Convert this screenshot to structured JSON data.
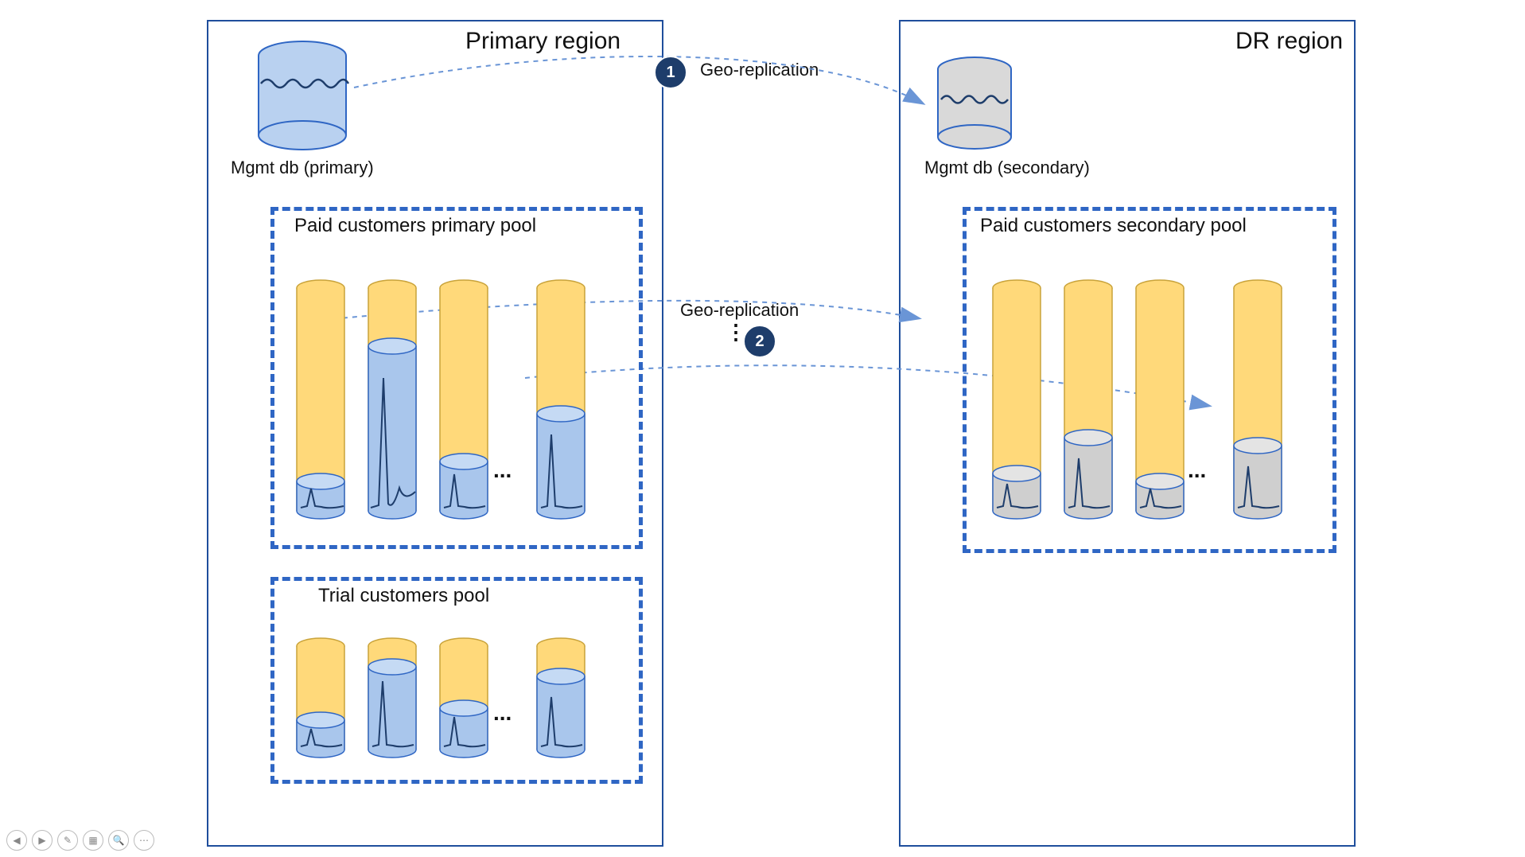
{
  "primary": {
    "title": "Primary region",
    "mgmt_label": "Mgmt db (primary)",
    "paid_pool_title": "Paid customers primary pool",
    "trial_pool_title": "Trial customers pool"
  },
  "dr": {
    "title": "DR region",
    "mgmt_label": "Mgmt db (secondary)",
    "paid_pool_title": "Paid customers secondary pool"
  },
  "georep": {
    "top_label": "Geo-replication",
    "mid_label": "Geo-replication",
    "badge1": "1",
    "badge2": "2"
  },
  "ellipses": {
    "paid_primary": "...",
    "paid_secondary": "...",
    "trial": "..."
  }
}
